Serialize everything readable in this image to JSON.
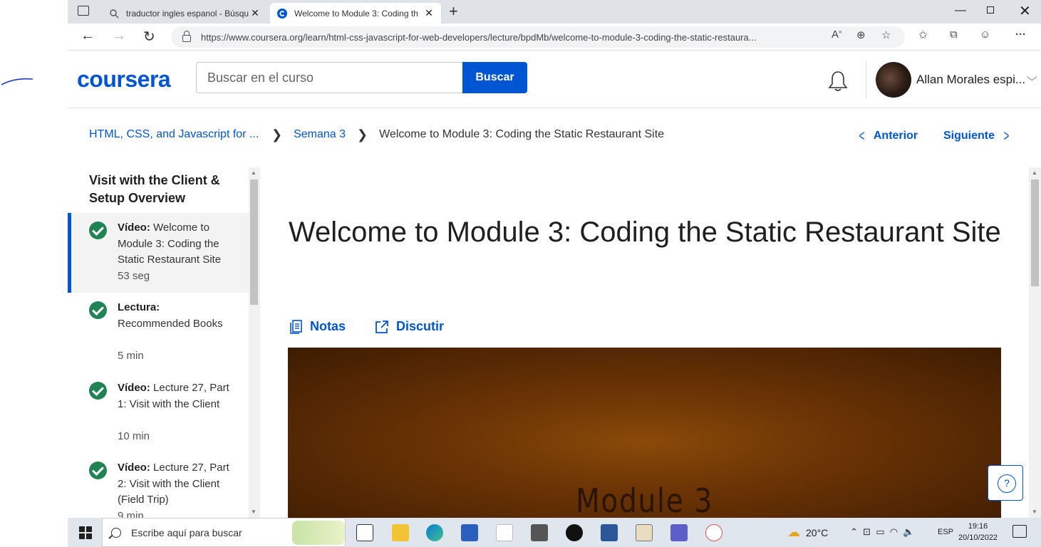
{
  "browser": {
    "tabs": [
      {
        "title": "traductor ingles espanol - Búsqu",
        "active": false
      },
      {
        "title": "Welcome to Module 3: Coding th",
        "active": true
      }
    ],
    "url": "https://www.coursera.org/learn/html-css-javascript-for-web-developers/lecture/bpdMb/welcome-to-module-3-coding-the-static-restaura..."
  },
  "header": {
    "logo": "coursera",
    "search_placeholder": "Buscar en el curso",
    "search_button": "Buscar",
    "user_name": "Allan Morales espi..."
  },
  "breadcrumb": {
    "course": "HTML, CSS, and Javascript for ...",
    "week": "Semana 3",
    "current": "Welcome to Module 3: Coding the Static Restaurant Site"
  },
  "pager": {
    "prev": "Anterior",
    "next": "Siguiente"
  },
  "sidebar": {
    "title": "Visit with the Client & Setup Overview",
    "items": [
      {
        "kind": "Vídeo:",
        "title": "Welcome to Module 3: Coding the Static Restaurant Site",
        "duration": "53 seg",
        "completed": true,
        "active": true
      },
      {
        "kind": "Lectura:",
        "title": "Recommended Books",
        "duration": "5 min",
        "completed": true,
        "active": false
      },
      {
        "kind": "Vídeo:",
        "title": "Lecture 27, Part 1: Visit with the Client",
        "duration": "10 min",
        "completed": true,
        "active": false
      },
      {
        "kind": "Vídeo:",
        "title": "Lecture 27, Part 2: Visit with the Client (Field Trip)",
        "duration": "9 min",
        "completed": true,
        "active": false
      }
    ]
  },
  "main": {
    "title": "Welcome to Module 3: Coding the Static Restaurant Site",
    "notes": "Notas",
    "discuss": "Discutir",
    "video_text": "Module 3"
  },
  "taskbar": {
    "search_placeholder": "Escribe aquí para buscar",
    "temperature": "20°C",
    "language": "ESP",
    "time": "19:16",
    "date": "20/10/2022"
  },
  "colors": {
    "brand": "#0056d2",
    "complete": "#1f8354"
  }
}
